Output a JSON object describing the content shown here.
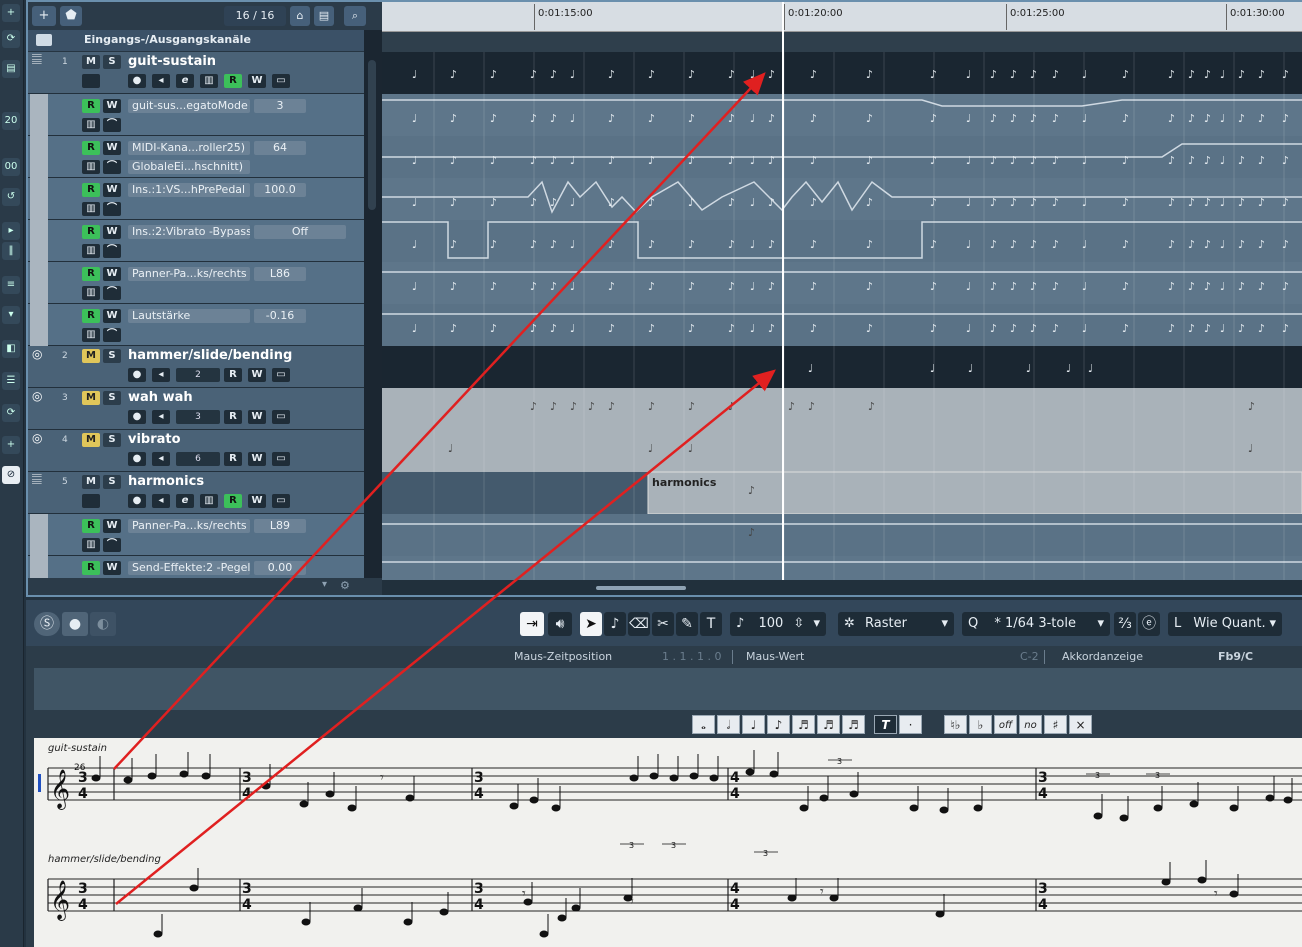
{
  "left_strip": {
    "items": [
      "plus",
      "20",
      "00"
    ]
  },
  "toolbar": {
    "add": "+",
    "counter": "16 / 16"
  },
  "tracklist": {
    "folder_label": "Eingangs-/Ausgangskanäle",
    "tracks": [
      {
        "number": "1",
        "name": "guit-sustain"
      },
      {
        "number": "2",
        "name": "hammer/slide/bending",
        "lane_value": "2"
      },
      {
        "number": "3",
        "name": "wah wah",
        "lane_value": "3"
      },
      {
        "number": "4",
        "name": "vibrato",
        "lane_value": "6"
      },
      {
        "number": "5",
        "name": "harmonics"
      }
    ],
    "automation": [
      {
        "param": "guit-sus...egatoMode",
        "value": "3"
      },
      {
        "param": "MIDI-Kana...roller25)",
        "value": "64",
        "param2": "GlobaleEi...hschnitt)"
      },
      {
        "param": "Ins.:1:VS...hPrePedal",
        "value": "100.0"
      },
      {
        "param": "Ins.:2:Vibrato -Bypass",
        "value": "Off"
      },
      {
        "param": "Panner-Pa...ks/rechts",
        "value": "L86"
      },
      {
        "param": "Lautstärke",
        "value": "-0.16"
      },
      {
        "param": "Panner-Pa...ks/rechts",
        "value": "L89"
      },
      {
        "param": "Send-Effekte:2 -Pegel",
        "value": "0.00"
      }
    ],
    "buttons": {
      "mute": "M",
      "solo": "S",
      "read": "R",
      "write": "W",
      "edit": "e"
    }
  },
  "ruler": {
    "ticks": [
      "0:01:15:00",
      "0:01:20:00",
      "0:01:25:00",
      "0:01:30:00"
    ]
  },
  "parts": {
    "harmonics_label": "harmonics"
  },
  "score_toolbar": {
    "velocity": "100",
    "snap_mode": "Raster",
    "quantize_label": "Q",
    "quantize": "* 1/64  3-tole",
    "length": "Wie Quant.",
    "length_prefix": "L"
  },
  "score_info": {
    "mouse_pos_label": "Maus-Zeitposition",
    "mouse_pos_value": "1 . 1 . 1 .   0",
    "mouse_value_label": "Maus-Wert",
    "mouse_value": "C-2",
    "chord_label": "Akkordanzeige",
    "chord_value": "Fb9/C"
  },
  "palette": {
    "note_values": [
      "𝅝",
      "𝅗𝅥",
      "♩",
      "♪",
      "♬",
      "♬",
      "♬"
    ],
    "triplet": "T",
    "dot": "·",
    "accidentals": [
      "♮♭",
      "♭",
      "off",
      "no",
      "♯",
      "×"
    ]
  },
  "score": {
    "staff1_label": "guit-sustain",
    "staff2_label": "hammer/slide/bending",
    "measure_number": "26",
    "time_signatures": [
      "3/4",
      "3/4",
      "3/4",
      "4/4",
      "3/4",
      "4/4"
    ],
    "tuplets": [
      "3",
      "3",
      "3",
      "3",
      "3",
      "3"
    ]
  },
  "colors": {
    "annotation_arrow": "#e02020",
    "record_green": "#3cc05a",
    "mute_yellow": "#e0c65a"
  }
}
